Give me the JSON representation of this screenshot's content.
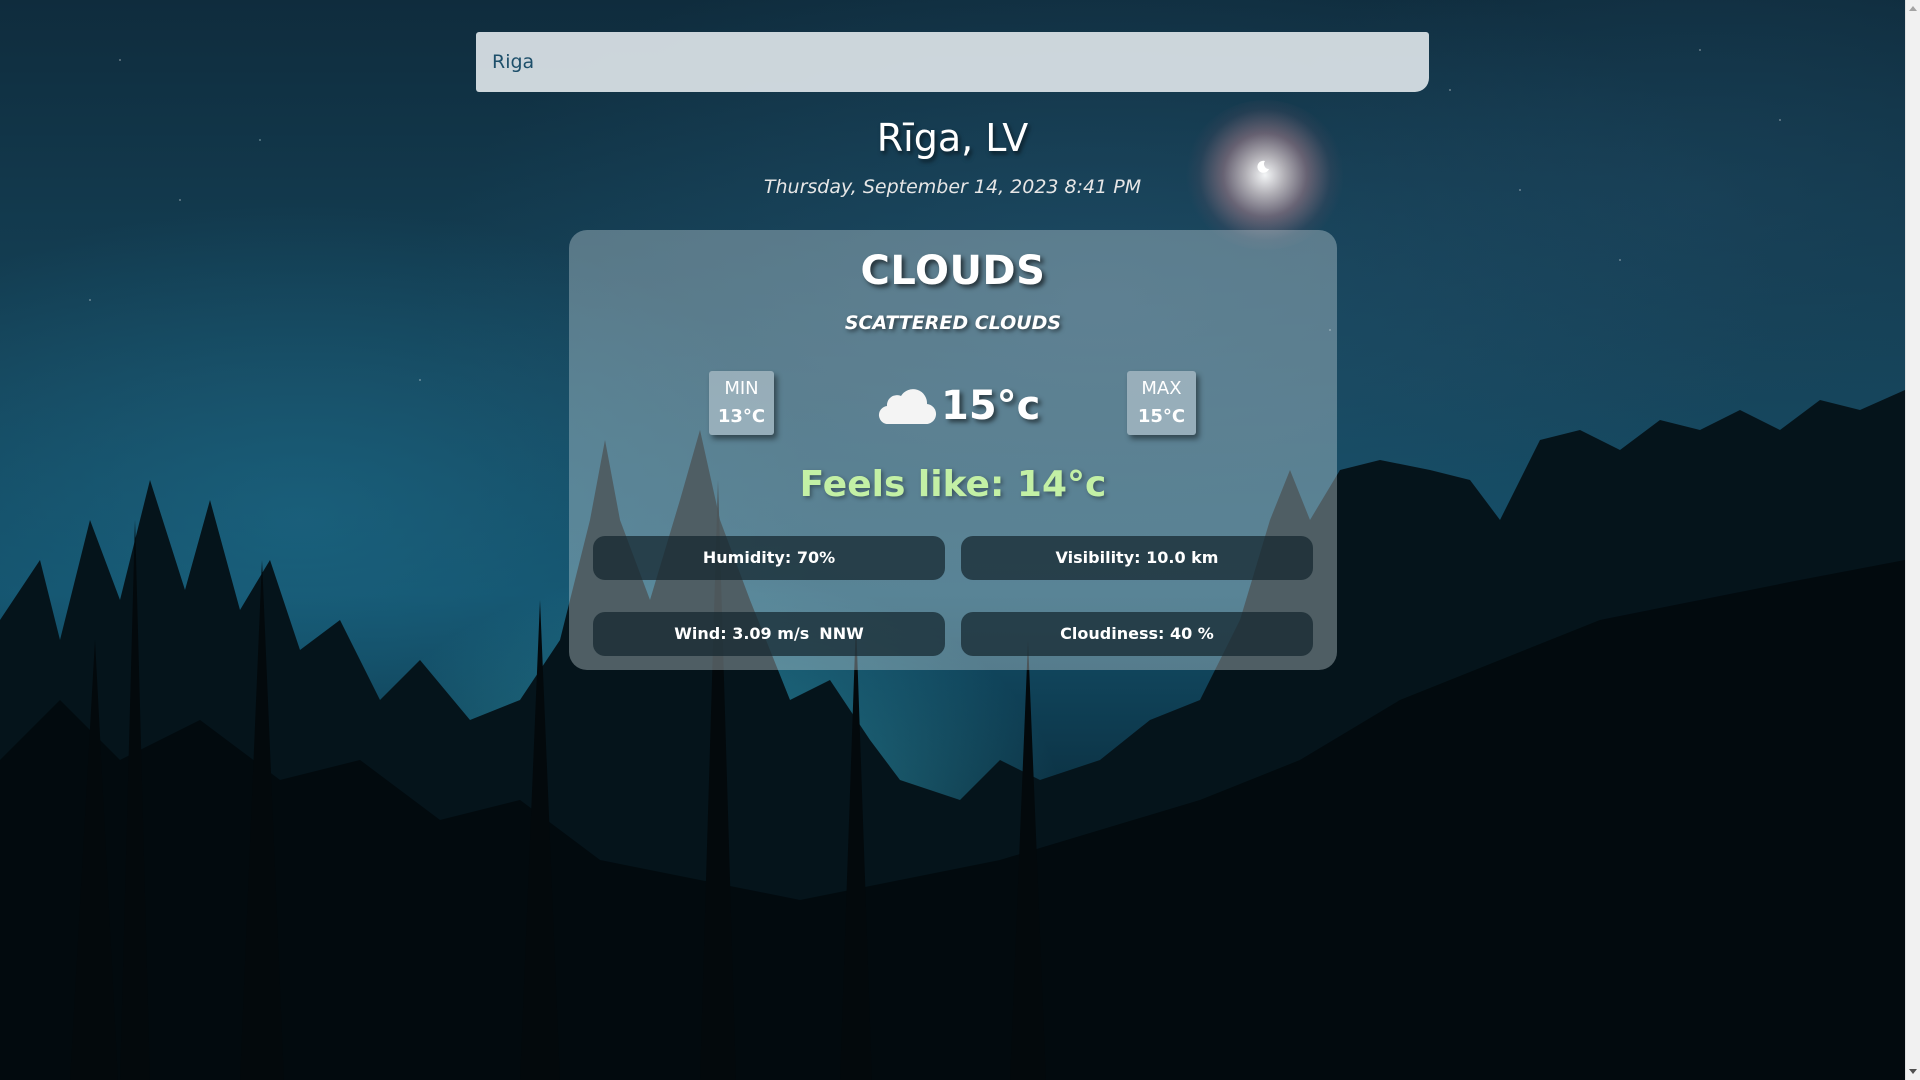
{
  "search": {
    "value": "Riga"
  },
  "location": {
    "city": "Rīga, LV",
    "datetime": "Thursday, September 14, 2023 8:41 PM"
  },
  "weather": {
    "condition": "CLOUDS",
    "description": "SCATTERED CLOUDS",
    "icon": "cloud-icon",
    "time_of_day_icon": "moon-icon",
    "temperature": "15°c",
    "min_label": "MIN",
    "min_value": "13°C",
    "max_label": "MAX",
    "max_value": "15°C",
    "feels_like": "Feels like: 14°c",
    "humidity": "Humidity: 70%",
    "visibility": "Visibility: 10.0 km",
    "wind": "Wind: 3.09 m/s",
    "wind_direction": "NNW",
    "cloudiness": "Cloudiness: 40 %"
  },
  "colors": {
    "feels_like": "#c3f0a5",
    "stat_bg": "#14262e",
    "search_text": "#1d4f6a"
  }
}
